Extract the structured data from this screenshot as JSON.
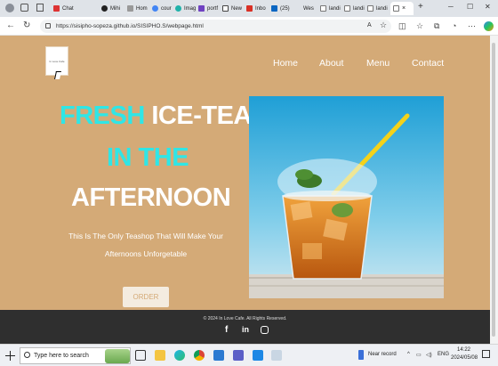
{
  "browser": {
    "tabs": [
      {
        "label": "Chat",
        "color": "#10a37f"
      },
      {
        "label": "Mihi",
        "color": "#222222"
      },
      {
        "label": "Hom",
        "color": "#555555"
      },
      {
        "label": "cour",
        "color": "#4285f4"
      },
      {
        "label": "Imag",
        "color": "#20b2aa"
      },
      {
        "label": "portf",
        "color": "#6f42c1"
      },
      {
        "label": "New",
        "color": "#444444"
      },
      {
        "label": "Inbo",
        "color": "#d93025"
      },
      {
        "label": "(25)",
        "color": "#0a66c2"
      },
      {
        "label": "Wes",
        "color": "#777777"
      },
      {
        "label": "landi",
        "color": "#777777"
      },
      {
        "label": "landi",
        "color": "#777777"
      },
      {
        "label": "landi",
        "color": "#777777"
      }
    ],
    "new_tab": "+",
    "url": "https://sisipho-sopeza.github.io/SISIPHO.S/webpage.html"
  },
  "site": {
    "logo_text": "In Love Cafe",
    "nav": [
      "Home",
      "About",
      "Menu",
      "Contact"
    ],
    "hero": {
      "line1_a": "FRESH",
      "line1_b": "ICE-TEA",
      "line2": "IN THE",
      "line3": "AFTERNOON",
      "sub1": "This Is The Only Teashop That Will Make Your",
      "sub2": "Afternoons Unforgetable",
      "button": "ORDER"
    },
    "footer": {
      "copyright": "© 2024 In Love Cafe. All Rights Reserved.",
      "social_icons": [
        "facebook-icon",
        "linkedin-icon",
        "instagram-icon"
      ]
    },
    "colors": {
      "background": "#d4aa77",
      "accent": "#2fe6e6",
      "footer": "#2f2f2f"
    }
  },
  "taskbar": {
    "search_placeholder": "Type here to search",
    "recording": "Near record",
    "language": "ENG",
    "time": "14:22",
    "date": "2024/05/08"
  }
}
